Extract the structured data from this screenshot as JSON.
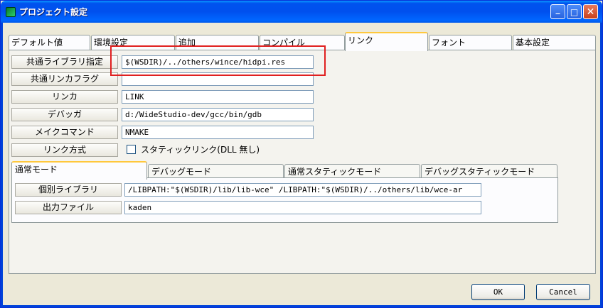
{
  "window": {
    "title": "プロジェクト設定",
    "buttons": {
      "minimize": "_",
      "maximize": "□",
      "close": "✕"
    },
    "app_icon": "project-cube-icon"
  },
  "tabs": [
    {
      "label": "デフォルト値",
      "active": false
    },
    {
      "label": "環境設定",
      "active": false
    },
    {
      "label": "追加",
      "active": false
    },
    {
      "label": "コンパイル",
      "active": false
    },
    {
      "label": "リンク",
      "active": true
    },
    {
      "label": "フォント",
      "active": false
    },
    {
      "label": "基本設定",
      "active": false
    }
  ],
  "link": {
    "rows": [
      {
        "label": "共通ライブラリ指定",
        "value": "$(WSDIR)/../others/wince/hidpi.res"
      },
      {
        "label": "共通リンカフラグ",
        "value": ""
      },
      {
        "label": "リンカ",
        "value": "LINK"
      },
      {
        "label": "デバッガ",
        "value": "d:/WideStudio-dev/gcc/bin/gdb"
      },
      {
        "label": "メイクコマンド",
        "value": "NMAKE"
      }
    ],
    "link_mode_label": "リンク方式",
    "static_link_label": "スタティックリンク(DLL 無し)",
    "static_link_checked": false
  },
  "mode_tabs": [
    {
      "label": "通常モード",
      "active": true
    },
    {
      "label": "デバッグモード",
      "active": false
    },
    {
      "label": "通常スタティックモード",
      "active": false
    },
    {
      "label": "デバッグスタティックモード",
      "active": false
    }
  ],
  "mode": {
    "rows": [
      {
        "label": "個別ライブラリ",
        "value": "/LIBPATH:\"$(WSDIR)/lib/lib-wce\" /LIBPATH:\"$(WSDIR)/../others/lib/wce-ar"
      },
      {
        "label": "出力ファイル",
        "value": "kaden"
      }
    ]
  },
  "footer": {
    "ok_label": "OK",
    "cancel_label": "Cancel"
  },
  "colors": {
    "highlight": "#e02020",
    "titlebar": "#0053ee",
    "tab_accent": "#ffc83c"
  }
}
